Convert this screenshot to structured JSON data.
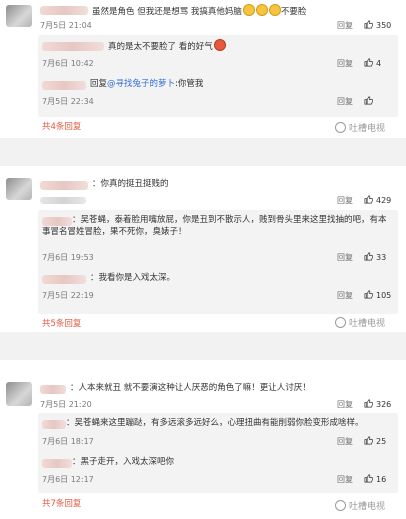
{
  "comments": [
    {
      "text": "虽然是角色 但我还是想骂 我搞真他妈脑",
      "text_tail": "不要脸",
      "time": "7月5日 21:04",
      "reply": "回复",
      "likes": "350",
      "replies": [
        {
          "text": "真的是太不要脸了 看的好气",
          "time": "7月6日 10:42",
          "reply": "回复",
          "likes": "4"
        },
        {
          "prefix": "回复",
          "mention": "@寻找兔子的萝卜",
          "text": ":你管我",
          "time": "7月5日 22:34",
          "reply": "回复",
          "likes": ""
        }
      ],
      "more": "共4条回复"
    },
    {
      "text": "你真的挺丑挺贱的",
      "time": "",
      "reply": "回复",
      "likes": "429",
      "replies": [
        {
          "text": "吴苍蝇，泰着脸用嘴放屁，你是丑到不散示人，贱到骨头里来这里找抽的吧，有本事冒名冒姓冒脸，果不死你，臭婊子！",
          "time": "7月6日 19:53",
          "reply": "回复",
          "likes": "33"
        },
        {
          "text": "我看你是入戏太深。",
          "time": "7月5日 22:19",
          "reply": "回复",
          "likes": "105"
        }
      ],
      "more": "共5条回复"
    },
    {
      "text": "人本来就丑 就不要演这种让人厌恶的角色了嘛！更让人讨厌！",
      "time": "7月5日 21:20",
      "reply": "回复",
      "likes": "326",
      "replies": [
        {
          "text": "吴苍蝇来这里蹦跶，有多远滚多远好么，心理扭曲有能削弱你脸变形成啥样。",
          "time": "7月6日 18:17",
          "reply": "回复",
          "likes": "25"
        },
        {
          "text": "黑子走开，入戏太深吧你",
          "time": "7月6日 12:17",
          "reply": "回复",
          "likes": "16"
        }
      ],
      "more": "共7条回复"
    }
  ],
  "watermark": "吐槽电视"
}
